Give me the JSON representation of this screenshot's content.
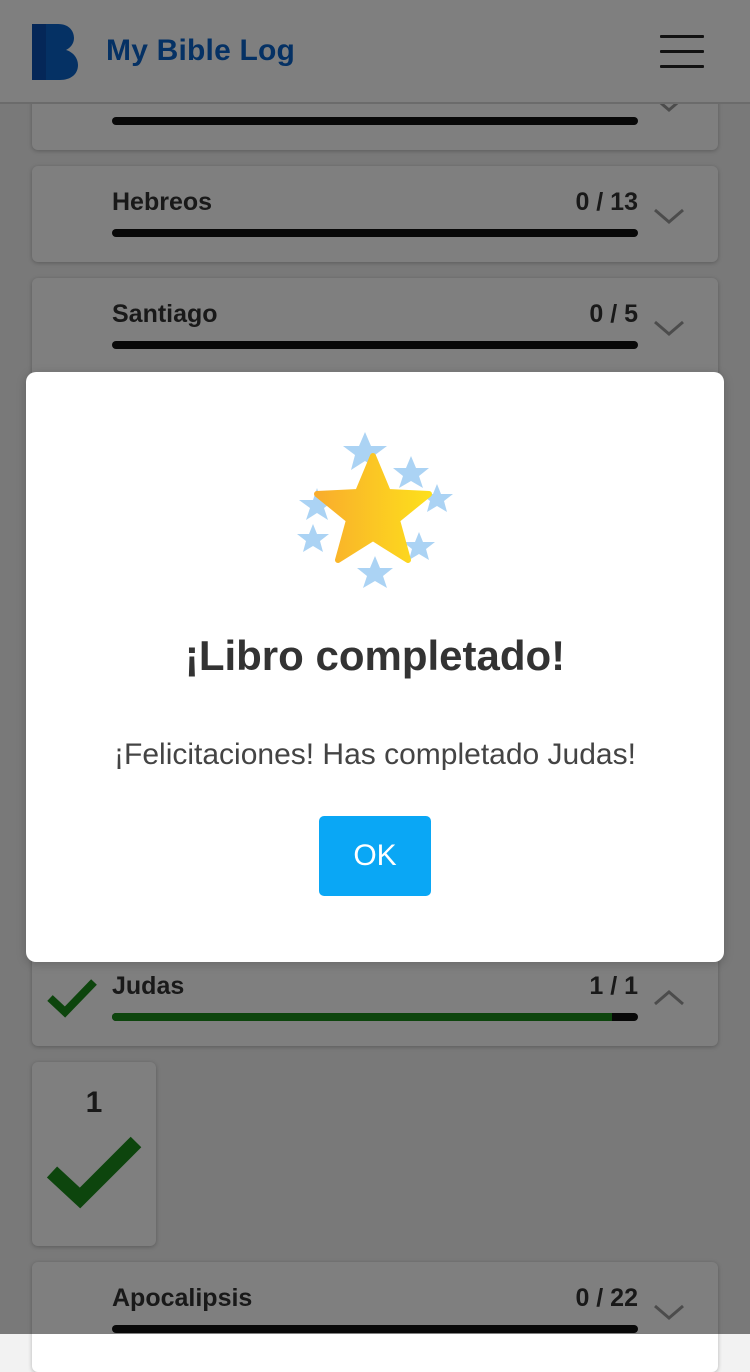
{
  "header": {
    "app_title": "My Bible Log",
    "logo_icon": "bible-log-logo-icon",
    "menu_icon": "hamburger-menu-icon",
    "brand_color": "#0a63c9"
  },
  "books": [
    {
      "name": "",
      "count": "",
      "progress": 0,
      "completed": false
    },
    {
      "name": "Hebreos",
      "count": "0 / 13",
      "progress": 0,
      "completed": false
    },
    {
      "name": "Santiago",
      "count": "0 / 5",
      "progress": 0,
      "completed": false
    },
    {
      "name": "Judas",
      "count": "1 / 1",
      "progress": 0.95,
      "completed": true,
      "expanded": true
    },
    {
      "name": "Apocalipsis",
      "count": "0 / 22",
      "progress": 0,
      "completed": false
    }
  ],
  "judas_chapters": [
    {
      "number": "1",
      "read": true
    }
  ],
  "modal": {
    "title": "¡Libro completado!",
    "message": "¡Felicitaciones! Has completado Judas!",
    "ok_label": "OK",
    "icon": "star-celebration-icon",
    "button_color": "#0aa7f5"
  }
}
